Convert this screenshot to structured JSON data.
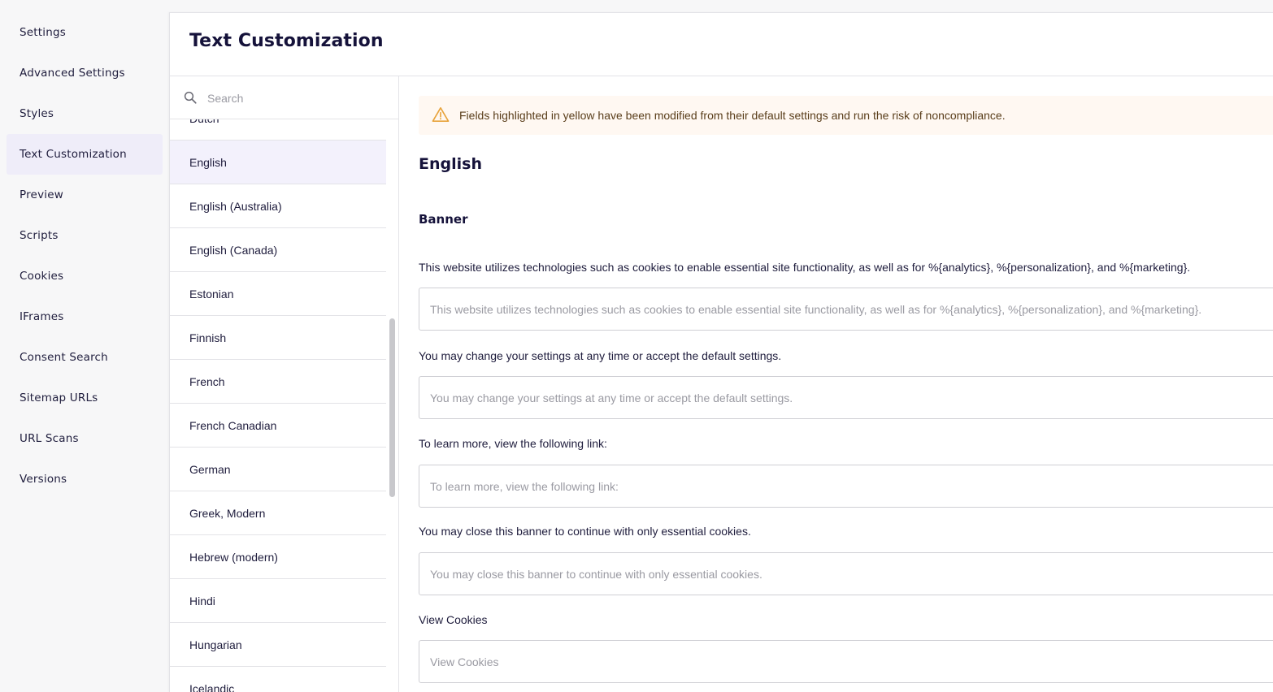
{
  "nav": {
    "items": [
      {
        "label": "Settings"
      },
      {
        "label": "Advanced Settings"
      },
      {
        "label": "Styles"
      },
      {
        "label": "Text Customization"
      },
      {
        "label": "Preview"
      },
      {
        "label": "Scripts"
      },
      {
        "label": "Cookies"
      },
      {
        "label": "IFrames"
      },
      {
        "label": "Consent Search"
      },
      {
        "label": "Sitemap URLs"
      },
      {
        "label": "URL Scans"
      },
      {
        "label": "Versions"
      }
    ],
    "active_index": 3
  },
  "page": {
    "title": "Text Customization"
  },
  "search": {
    "placeholder": "Search",
    "value": ""
  },
  "languages": {
    "items": [
      {
        "label": "Dutch"
      },
      {
        "label": "English"
      },
      {
        "label": "English (Australia)"
      },
      {
        "label": "English (Canada)"
      },
      {
        "label": "Estonian"
      },
      {
        "label": "Finnish"
      },
      {
        "label": "French"
      },
      {
        "label": "French Canadian"
      },
      {
        "label": "German"
      },
      {
        "label": "Greek, Modern"
      },
      {
        "label": "Hebrew (modern)"
      },
      {
        "label": "Hindi"
      },
      {
        "label": "Hungarian"
      },
      {
        "label": "Icelandic"
      }
    ],
    "selected": "English"
  },
  "warning": {
    "icon": "warning-triangle-icon",
    "text": "Fields highlighted in yellow have been modified from their default settings and run the risk of noncompliance."
  },
  "content": {
    "language_heading": "English",
    "section_heading": "Banner",
    "fields": [
      {
        "label": "This website utilizes technologies such as cookies to enable essential site functionality, as well as for %{analytics}, %{personalization}, and %{marketing}.",
        "placeholder": "This website utilizes technologies such as cookies to enable essential site functionality, as well as for %{analytics}, %{personalization}, and %{marketing}.",
        "value": ""
      },
      {
        "label": "You may change your settings at any time or accept the default settings.",
        "placeholder": "You may change your settings at any time or accept the default settings.",
        "value": ""
      },
      {
        "label": "To learn more, view the following link:",
        "placeholder": "To learn more, view the following link:",
        "value": ""
      },
      {
        "label": "You may close this banner to continue with only essential cookies.",
        "placeholder": "You may close this banner to continue with only essential cookies.",
        "value": ""
      },
      {
        "label": "View Cookies",
        "placeholder": "View Cookies",
        "value": ""
      }
    ]
  },
  "colors": {
    "accent_active_bg": "#efedf9",
    "warning_bg": "#fff8f2",
    "warning_icon": "#e8a33b",
    "heading": "#15123a"
  }
}
